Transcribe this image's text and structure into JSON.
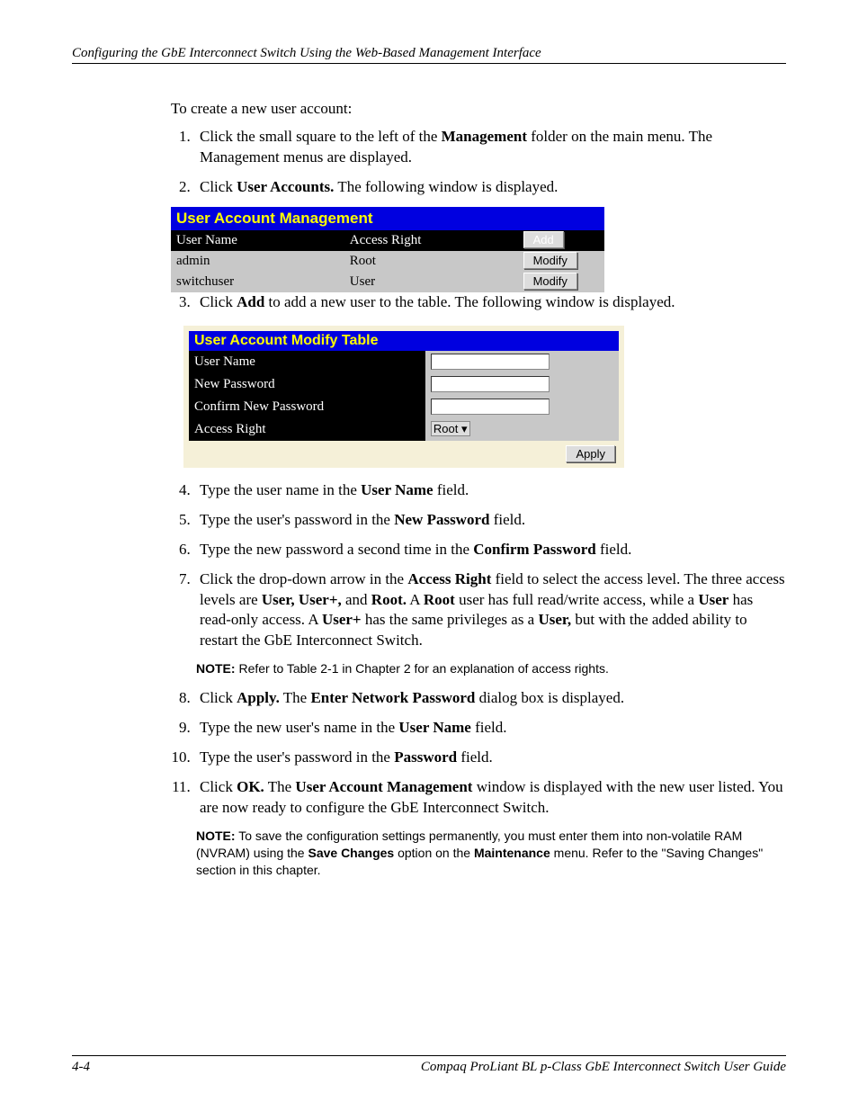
{
  "header": "Configuring the GbE Interconnect Switch Using the Web-Based Management Interface",
  "intro": "To create a new user account:",
  "steps": {
    "s1a": "Click the small square to the left of the ",
    "s1b": "Management",
    "s1c": " folder on the main menu. The Management menus are displayed.",
    "s2a": "Click ",
    "s2b": "User Accounts.",
    "s2c": " The following window is displayed.",
    "s3a": "Click ",
    "s3b": "Add",
    "s3c": " to add a new user to the table. The following window is displayed.",
    "s4a": "Type the user name in the ",
    "s4b": "User Name",
    "s4c": " field.",
    "s5a": "Type the user's password in the ",
    "s5b": "New Password",
    "s5c": " field.",
    "s6a": "Type the new password a second time in the ",
    "s6b": "Confirm Password",
    "s6c": " field.",
    "s7a": "Click the drop-down arrow in the ",
    "s7b": "Access Right",
    "s7c": " field to select the access level. The three access levels are ",
    "s7d": "User, User+,",
    "s7e": " and ",
    "s7f": "Root.",
    "s7g": " A ",
    "s7h": "Root",
    "s7i": " user has full read/write access, while a ",
    "s7j": "User",
    "s7k": " has read-only access. A ",
    "s7l": "User+",
    "s7m": " has the same privileges as a ",
    "s7n": "User,",
    "s7o": " but with the added ability to restart the GbE Interconnect Switch.",
    "s8a": "Click ",
    "s8b": "Apply.",
    "s8c": " The ",
    "s8d": "Enter Network Password",
    "s8e": " dialog box is displayed.",
    "s9a": "Type the new user's name in the ",
    "s9b": "User Name",
    "s9c": " field.",
    "s10a": "Type the user's password in the ",
    "s10b": "Password",
    "s10c": " field.",
    "s11a": "Click ",
    "s11b": "OK.",
    "s11c": " The ",
    "s11d": "User Account Management",
    "s11e": " window is displayed with the new user listed. You are now ready to configure the GbE Interconnect Switch."
  },
  "uam": {
    "title": "User Account Management",
    "col1": "User Name",
    "col2": "Access Right",
    "addBtn": "Add",
    "rows": [
      {
        "name": "admin",
        "right": "Root",
        "btn": "Modify"
      },
      {
        "name": "switchuser",
        "right": "User",
        "btn": "Modify"
      }
    ]
  },
  "modify": {
    "title": "User Account Modify Table",
    "userName": "User Name",
    "newPassword": "New Password",
    "confirm": "Confirm New Password",
    "accessRight": "Access Right",
    "rootOption": "Root",
    "applyBtn": "Apply"
  },
  "note1": {
    "label": "NOTE:",
    "text": "  Refer to Table 2-1 in Chapter 2 for an explanation of access rights."
  },
  "note2": {
    "label": "NOTE:",
    "t1": "  To save the configuration settings permanently, you must enter them into non-volatile RAM (NVRAM) using the ",
    "t2": "Save Changes",
    "t3": " option on the ",
    "t4": "Maintenance",
    "t5": " menu. Refer to the \"Saving Changes\" section in this chapter."
  },
  "footer": {
    "page": "4-4",
    "doc": "Compaq ProLiant BL p-Class GbE Interconnect Switch User Guide"
  }
}
